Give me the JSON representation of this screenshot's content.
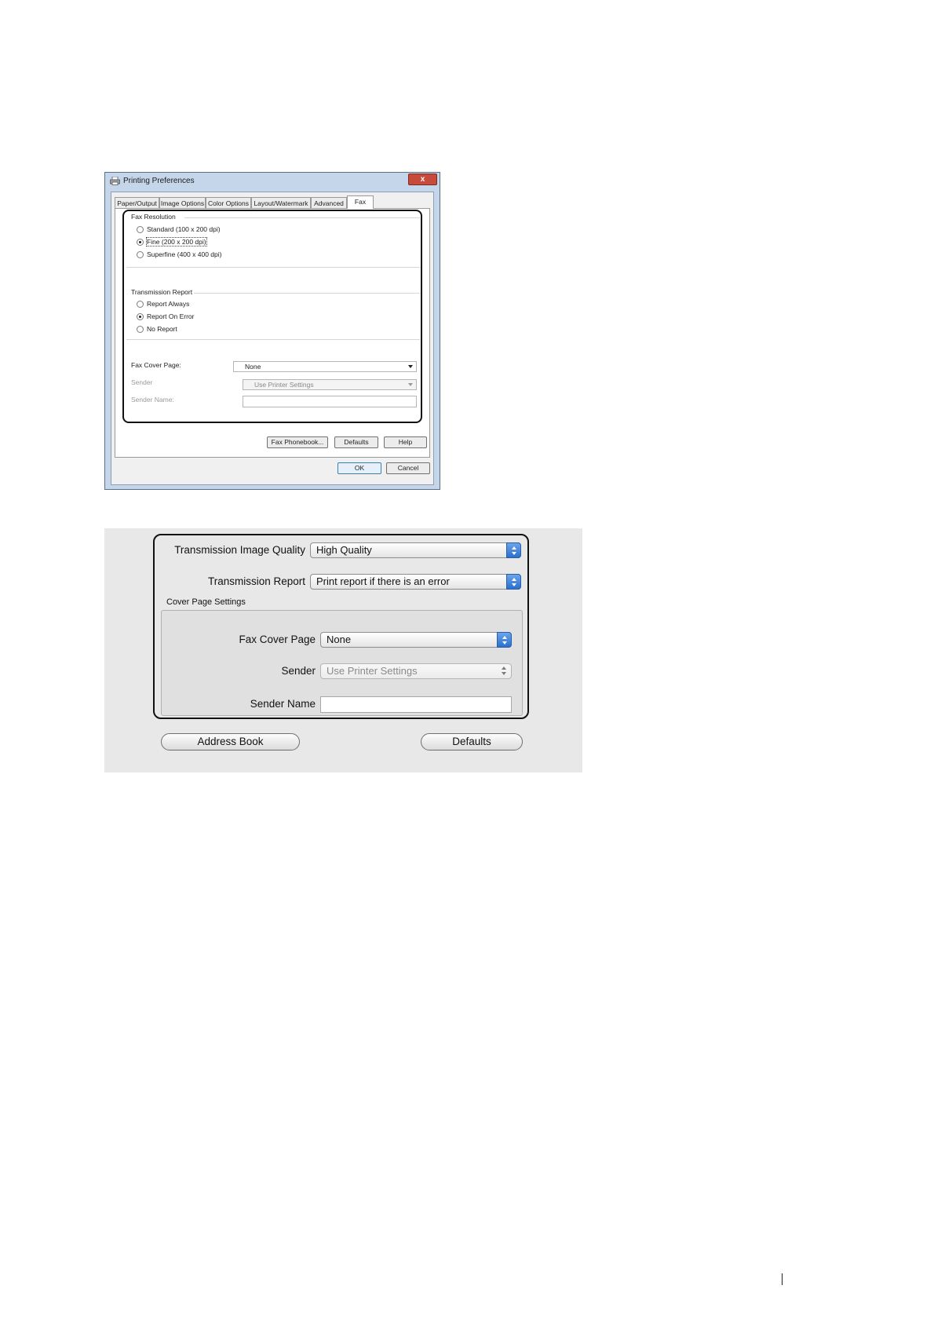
{
  "windows_dialog": {
    "title": "Printing Preferences",
    "close_label": "x",
    "tabs": [
      "Paper/Output",
      "Image Options",
      "Color Options",
      "Layout/Watermark",
      "Advanced",
      "Fax"
    ],
    "active_tab": "Fax",
    "fax_resolution": {
      "label": "Fax Resolution",
      "options": [
        "Standard (100 x 200 dpi)",
        "Fine (200 x 200 dpi)",
        "Superfine (400 x 400 dpi)"
      ],
      "selected": "Fine (200 x 200 dpi)"
    },
    "transmission_report": {
      "label": "Transmission Report",
      "options": [
        "Report Always",
        "Report On Error",
        "No Report"
      ],
      "selected": "Report On Error"
    },
    "fax_cover_page": {
      "label": "Fax Cover Page:",
      "value": "None"
    },
    "sender": {
      "label": "Sender",
      "value": "Use Printer Settings"
    },
    "sender_name": {
      "label": "Sender Name:",
      "value": ""
    },
    "buttons": {
      "fax_phonebook": "Fax Phonebook...",
      "defaults": "Defaults",
      "help": "Help",
      "ok": "OK",
      "cancel": "Cancel"
    }
  },
  "mac_panel": {
    "transmission_image_quality": {
      "label": "Transmission Image Quality",
      "value": "High Quality"
    },
    "transmission_report": {
      "label": "Transmission Report",
      "value": "Print report if there is an error"
    },
    "cover_page_settings": {
      "label": "Cover Page Settings",
      "fax_cover_page": {
        "label": "Fax Cover Page",
        "value": "None"
      },
      "sender": {
        "label": "Sender",
        "value": "Use Printer Settings"
      },
      "sender_name": {
        "label": "Sender Name",
        "value": ""
      }
    },
    "buttons": {
      "address_book": "Address Book",
      "defaults": "Defaults"
    }
  }
}
